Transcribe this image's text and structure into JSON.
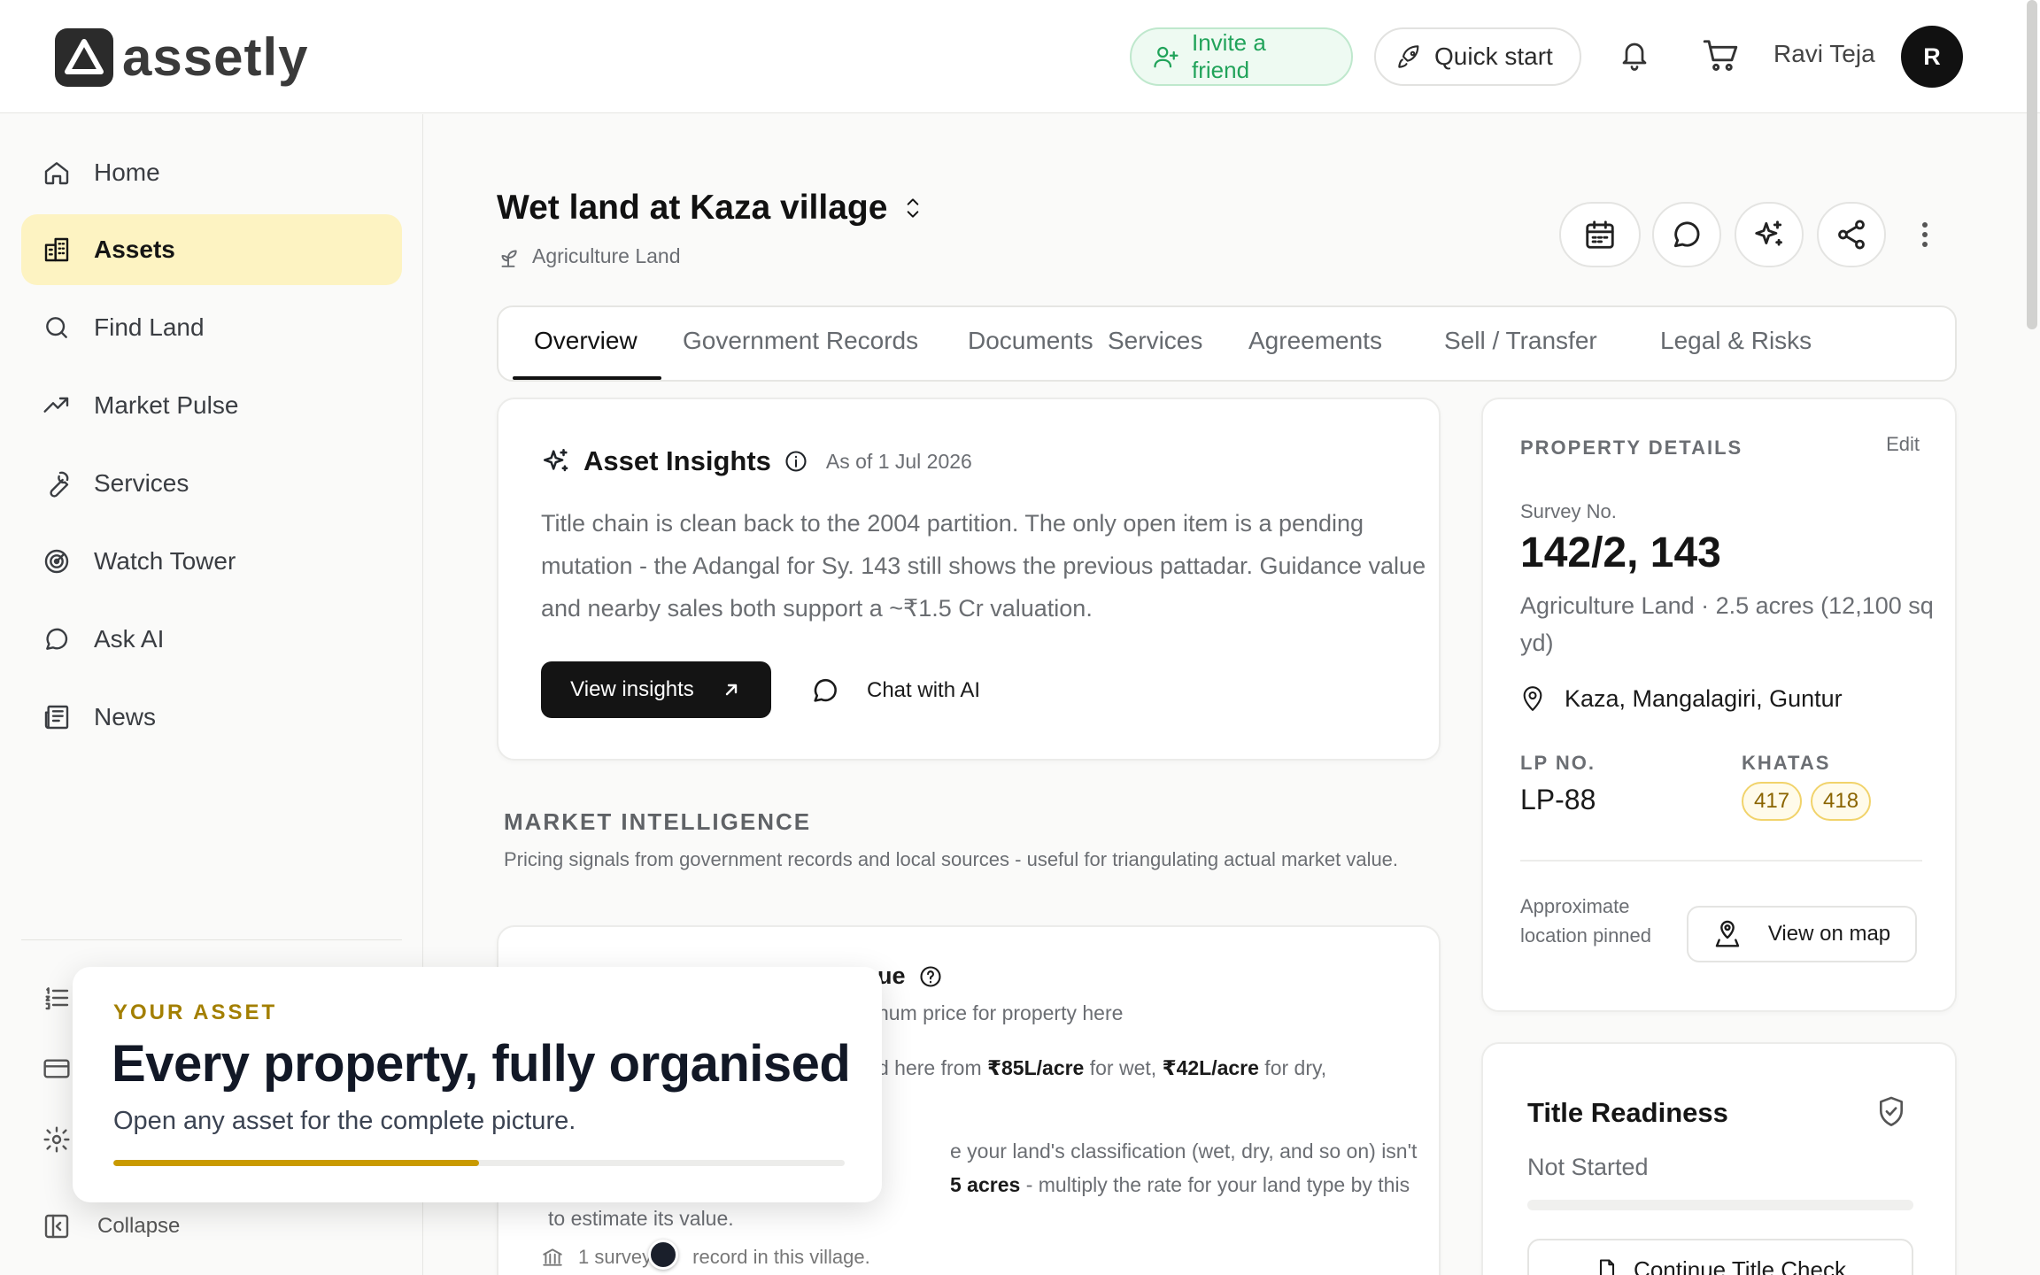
{
  "app": {
    "logo_text": "assetly"
  },
  "header": {
    "invite_label": "Invite a friend",
    "quick_start_label": "Quick start",
    "user_name": "Ravi Teja",
    "avatar_initial": "R",
    "colors": {
      "invite_green": "#21a35a",
      "accent_yellow": "#fdf3c2"
    }
  },
  "sidebar": {
    "items": [
      {
        "label": "Home",
        "icon": "home-icon"
      },
      {
        "label": "Assets",
        "icon": "building-icon",
        "active": true
      },
      {
        "label": "Find Land",
        "icon": "search-icon"
      },
      {
        "label": "Market Pulse",
        "icon": "trending-up-icon"
      },
      {
        "label": "Services",
        "icon": "wrench-icon"
      },
      {
        "label": "Watch Tower",
        "icon": "radar-icon"
      },
      {
        "label": "Ask AI",
        "icon": "chat-bubble-icon"
      },
      {
        "label": "News",
        "icon": "newspaper-icon"
      }
    ],
    "collapse_label": "Collapse"
  },
  "page": {
    "title": "Wet land at Kaza village",
    "subtitle": "Agriculture Land",
    "tabs": [
      {
        "label": "Overview",
        "active": true
      },
      {
        "label": "Government Records"
      },
      {
        "label": "Documents"
      },
      {
        "label": "Services"
      },
      {
        "label": "Agreements"
      },
      {
        "label": "Sell / Transfer"
      },
      {
        "label": "Legal & Risks"
      }
    ]
  },
  "insights": {
    "title": "Asset Insights",
    "as_of": "As of 1 Jul 2026",
    "body": "Title chain is clean back to the 2004 partition. The only open item is a pending mutation - the Adangal for Sy. 143 still shows the previous pattadar. Guidance value and nearby sales both support a ~₹1.5 Cr valuation.",
    "view_label": "View insights",
    "chat_label": "Chat with AI"
  },
  "market": {
    "title": "MARKET INTELLIGENCE",
    "description": "Pricing signals from government records and local sources - useful for triangulating actual market value.",
    "guidance_title_tail": "ue",
    "guidance_sub_tail": "num price for property here",
    "line1_pre": "d here from ",
    "line1_wet": "₹85L/acre",
    "line1_mid": " for wet, ",
    "line1_dry": "₹42L/acre",
    "line1_post": " for dry,",
    "line2": "e your land's classification (wet, dry, and so on) isn't",
    "line3_bold": "5 acres",
    "line3_post": " - multiply the rate for your land type by this",
    "line4": "to estimate its value.",
    "footer_pre": "1 survey",
    "footer_post": "record in this village."
  },
  "property": {
    "section_title": "PROPERTY DETAILS",
    "edit_label": "Edit",
    "survey_label": "Survey No.",
    "survey_value": "142/2, 143",
    "land_info": "Agriculture Land · 2.5 acres (12,100 sq yd)",
    "location": "Kaza, Mangalagiri, Guntur",
    "lp_label": "LP NO.",
    "lp_value": "LP-88",
    "khatas_label": "KHATAS",
    "khatas": [
      "417",
      "418"
    ],
    "approx_label": "Approximate location pinned",
    "map_label": "View on map"
  },
  "title_readiness": {
    "title": "Title Readiness",
    "status": "Not Started",
    "button_label": "Continue Title Check"
  },
  "onboarding": {
    "eyebrow": "YOUR ASSET",
    "title": "Every property, fully organised",
    "subtitle": "Open any asset for the complete picture.",
    "progress": 0.5,
    "accent": "#c99a00"
  }
}
